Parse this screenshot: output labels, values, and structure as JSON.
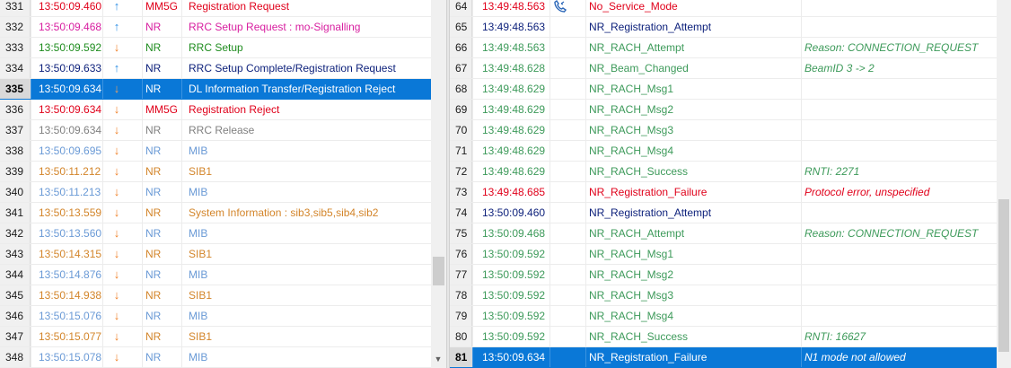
{
  "left_table": {
    "rows": [
      {
        "idx": "331",
        "time": "13:50:09.460",
        "dir": "up",
        "proto": "MM5G",
        "msg": "Registration Request",
        "color": "#e0001a"
      },
      {
        "idx": "332",
        "time": "13:50:09.468",
        "dir": "up",
        "proto": "NR",
        "msg": "RRC Setup Request : mo-Signalling",
        "color": "#d81fa0"
      },
      {
        "idx": "333",
        "time": "13:50:09.592",
        "dir": "down",
        "proto": "NR",
        "msg": "RRC Setup",
        "color": "#1e8c1e"
      },
      {
        "idx": "334",
        "time": "13:50:09.633",
        "dir": "up",
        "proto": "NR",
        "msg": "RRC Setup Complete/Registration Request",
        "color": "#0b1f7a"
      },
      {
        "idx": "335",
        "time": "13:50:09.634",
        "dir": "down",
        "proto": "NR",
        "msg": "DL Information Transfer/Registration Reject",
        "color": "#ffffff",
        "selected": true
      },
      {
        "idx": "336",
        "time": "13:50:09.634",
        "dir": "down",
        "proto": "MM5G",
        "msg": "Registration Reject",
        "color": "#e0001a"
      },
      {
        "idx": "337",
        "time": "13:50:09.634",
        "dir": "down",
        "proto": "NR",
        "msg": "RRC Release",
        "color": "#808080"
      },
      {
        "idx": "338",
        "time": "13:50:09.695",
        "dir": "down",
        "proto": "NR",
        "msg": "MIB",
        "color": "#6a9ad6"
      },
      {
        "idx": "339",
        "time": "13:50:11.212",
        "dir": "down",
        "proto": "NR",
        "msg": "SIB1",
        "color": "#d3852a"
      },
      {
        "idx": "340",
        "time": "13:50:11.213",
        "dir": "down",
        "proto": "NR",
        "msg": "MIB",
        "color": "#6a9ad6"
      },
      {
        "idx": "341",
        "time": "13:50:13.559",
        "dir": "down",
        "proto": "NR",
        "msg": "System Information : sib3,sib5,sib4,sib2",
        "color": "#d3852a"
      },
      {
        "idx": "342",
        "time": "13:50:13.560",
        "dir": "down",
        "proto": "NR",
        "msg": "MIB",
        "color": "#6a9ad6"
      },
      {
        "idx": "343",
        "time": "13:50:14.315",
        "dir": "down",
        "proto": "NR",
        "msg": "SIB1",
        "color": "#d3852a"
      },
      {
        "idx": "344",
        "time": "13:50:14.876",
        "dir": "down",
        "proto": "NR",
        "msg": "MIB",
        "color": "#6a9ad6"
      },
      {
        "idx": "345",
        "time": "13:50:14.938",
        "dir": "down",
        "proto": "NR",
        "msg": "SIB1",
        "color": "#d3852a"
      },
      {
        "idx": "346",
        "time": "13:50:15.076",
        "dir": "down",
        "proto": "NR",
        "msg": "MIB",
        "color": "#6a9ad6"
      },
      {
        "idx": "347",
        "time": "13:50:15.077",
        "dir": "down",
        "proto": "NR",
        "msg": "SIB1",
        "color": "#d3852a"
      },
      {
        "idx": "348",
        "time": "13:50:15.078",
        "dir": "down",
        "proto": "NR",
        "msg": "MIB",
        "color": "#6a9ad6"
      }
    ],
    "arrow_colors": {
      "up": "#2e8fe6",
      "down": "#f0822a"
    }
  },
  "right_table": {
    "rows": [
      {
        "idx": "64",
        "time": "13:49:48.563",
        "event": "No_Service_Mode",
        "info": "",
        "color": "#e0001a",
        "icon": "phone-icon"
      },
      {
        "idx": "65",
        "time": "13:49:48.563",
        "event": "NR_Registration_Attempt",
        "info": "",
        "color": "#0b1f7a"
      },
      {
        "idx": "66",
        "time": "13:49:48.563",
        "event": "NR_RACH_Attempt",
        "info": "Reason: CONNECTION_REQUEST",
        "color": "#3d9a5a"
      },
      {
        "idx": "67",
        "time": "13:49:48.628",
        "event": "NR_Beam_Changed",
        "info": "BeamID 3 -> 2",
        "color": "#3d9a5a"
      },
      {
        "idx": "68",
        "time": "13:49:48.629",
        "event": "NR_RACH_Msg1",
        "info": "",
        "color": "#3d9a5a"
      },
      {
        "idx": "69",
        "time": "13:49:48.629",
        "event": "NR_RACH_Msg2",
        "info": "",
        "color": "#3d9a5a"
      },
      {
        "idx": "70",
        "time": "13:49:48.629",
        "event": "NR_RACH_Msg3",
        "info": "",
        "color": "#3d9a5a"
      },
      {
        "idx": "71",
        "time": "13:49:48.629",
        "event": "NR_RACH_Msg4",
        "info": "",
        "color": "#3d9a5a"
      },
      {
        "idx": "72",
        "time": "13:49:48.629",
        "event": "NR_RACH_Success",
        "info": "RNTI: 2271",
        "color": "#3d9a5a"
      },
      {
        "idx": "73",
        "time": "13:49:48.685",
        "event": "NR_Registration_Failure",
        "info": "Protocol error, unspecified",
        "color": "#e0001a"
      },
      {
        "idx": "74",
        "time": "13:50:09.460",
        "event": "NR_Registration_Attempt",
        "info": "",
        "color": "#0b1f7a"
      },
      {
        "idx": "75",
        "time": "13:50:09.468",
        "event": "NR_RACH_Attempt",
        "info": "Reason: CONNECTION_REQUEST",
        "color": "#3d9a5a"
      },
      {
        "idx": "76",
        "time": "13:50:09.592",
        "event": "NR_RACH_Msg1",
        "info": "",
        "color": "#3d9a5a"
      },
      {
        "idx": "77",
        "time": "13:50:09.592",
        "event": "NR_RACH_Msg2",
        "info": "",
        "color": "#3d9a5a"
      },
      {
        "idx": "78",
        "time": "13:50:09.592",
        "event": "NR_RACH_Msg3",
        "info": "",
        "color": "#3d9a5a"
      },
      {
        "idx": "79",
        "time": "13:50:09.592",
        "event": "NR_RACH_Msg4",
        "info": "",
        "color": "#3d9a5a"
      },
      {
        "idx": "80",
        "time": "13:50:09.592",
        "event": "NR_RACH_Success",
        "info": "RNTI: 16627",
        "color": "#3d9a5a"
      },
      {
        "idx": "81",
        "time": "13:50:09.634",
        "event": "NR_Registration_Failure",
        "info": "N1 mode not allowed",
        "color": "#ffffff",
        "selected": true
      }
    ]
  }
}
